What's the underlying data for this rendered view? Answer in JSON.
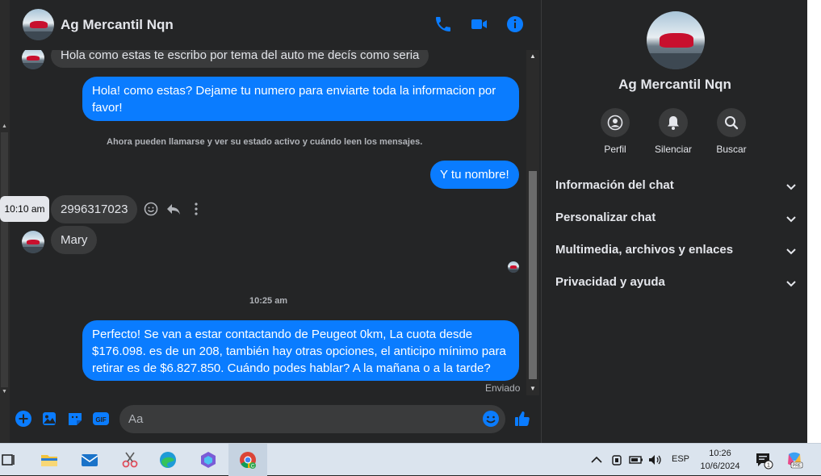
{
  "header": {
    "title": "Ag Mercantil Nqn",
    "icons": [
      "phone-icon",
      "video-icon",
      "info-icon"
    ],
    "accent": "#0a7cff"
  },
  "messages": {
    "m1": "Hola como estas te escribo por tema del auto me decís como seria",
    "m2": "Hola! como estas? Dejame tu numero para enviarte toda la informacion por favor!",
    "system_note": "Ahora pueden llamarse y ver su estado activo y cuándo leen los mensajes.",
    "m3": "Y tu nombre!",
    "m4": "2996317023",
    "m4_time": "10:10 am",
    "m5": "Mary",
    "time_divider": "10:25 am",
    "m6": "Perfecto!  Se van a estar contactando de Peugeot 0km, La cuota desde $176.098. es de un 208, también hay otras opciones, el anticipo mínimo para retirar es de $6.827.850. Cuándo podes hablar? A la mañana o a la tarde?",
    "sent_status": "Enviado"
  },
  "composer": {
    "placeholder": "Aa"
  },
  "right_panel": {
    "name": "Ag Mercantil Nqn",
    "actions": [
      {
        "label": "Perfil",
        "icon": "profile-icon"
      },
      {
        "label": "Silenciar",
        "icon": "bell-icon"
      },
      {
        "label": "Buscar",
        "icon": "search-icon"
      }
    ],
    "sections": [
      "Información del chat",
      "Personalizar chat",
      "Multimedia, archivos y enlaces",
      "Privacidad y ayuda"
    ]
  },
  "taskbar": {
    "language": "ESP",
    "time": "10:26",
    "date": "10/6/2024",
    "notification_count": "1"
  }
}
